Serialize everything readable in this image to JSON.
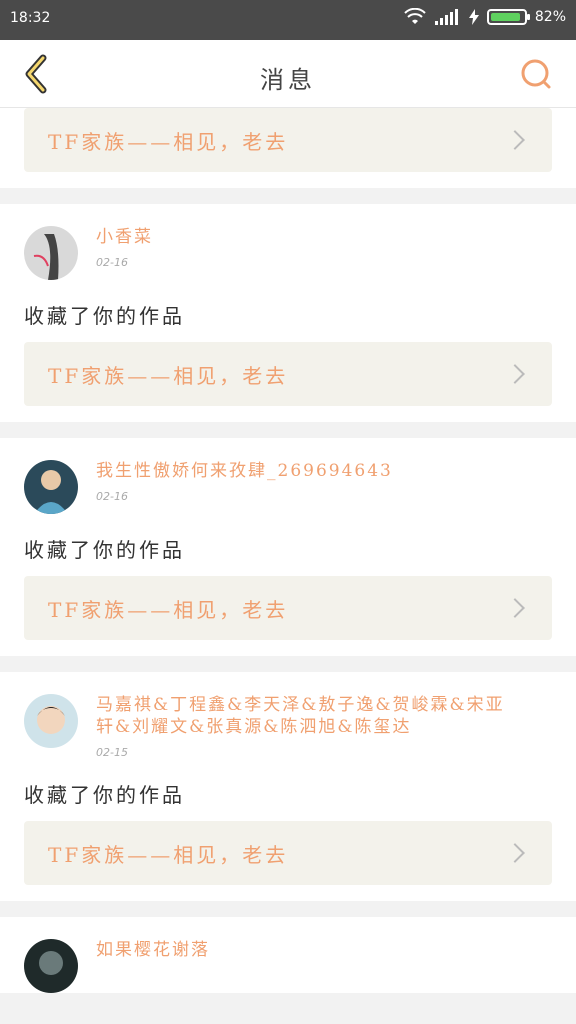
{
  "status_bar": {
    "time": "18:32",
    "battery": "82%"
  },
  "header": {
    "title": "消息"
  },
  "icons": {
    "back": "chevron-left-icon",
    "search": "search-icon"
  },
  "colors": {
    "accent": "#f0a070",
    "header_bg": "#ffffff",
    "link_bg": "#f3f2eb"
  },
  "feed": {
    "top_link": "TF家族——相见，老去",
    "items": [
      {
        "username": "小香菜",
        "date": "02-16",
        "action": "收藏了你的作品",
        "link": "TF家族——相见，老去"
      },
      {
        "username": "我生性傲娇何来孜肆_269694643",
        "date": "02-16",
        "action": "收藏了你的作品",
        "link": "TF家族——相见，老去"
      },
      {
        "username": "马嘉祺&丁程鑫&李天泽&敖子逸&贺峻霖&宋亚轩&刘耀文&张真源&陈泗旭&陈玺达",
        "date": "02-15",
        "action": "收藏了你的作品",
        "link": "TF家族——相见，老去"
      },
      {
        "username": "如果樱花谢落",
        "date": "",
        "action": "",
        "link": ""
      }
    ]
  }
}
